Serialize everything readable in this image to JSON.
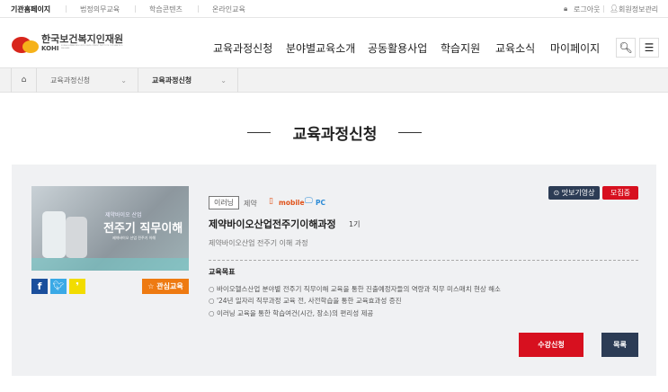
{
  "topbar": {
    "links": [
      "기관홈페이지",
      "법정의무교육",
      "학습콘텐츠",
      "온라인교육"
    ],
    "logout": "로그아웃",
    "member": "회원정보관리"
  },
  "logo": {
    "name": "한국보건복지인재원",
    "abbr": "KOHI",
    "sub": "KOREA HUMAN RESOURCE DEVELOPMENT INSTITUTE FOR HEALTH & WELFARE"
  },
  "nav": [
    "교육과정신청",
    "분야별교육소개",
    "공동활용사업",
    "학습지원",
    "교육소식",
    "마이페이지"
  ],
  "breadcrumb": [
    "교육과정신청",
    "교육과정신청"
  ],
  "page_title": "교육과정신청",
  "course": {
    "thumb": {
      "small": "제약바이오 산업",
      "big": "전주기 직무이해",
      "caption": "제약바이오 산업 전주기 이해"
    },
    "type_tag": "이러닝",
    "category": "제약",
    "mobile": "mobile",
    "pc": "PC",
    "preview": "맛보기영상",
    "status": "모집중",
    "title": "제약바이오산업전주기이해과정",
    "term": "1기",
    "subtitle": "제약바이오산업 전주기 이해 과정",
    "goal_label": "교육목표",
    "goals": [
      "바이오헬스산업 분야별 전주기 직무이해 교육을 통한 진출예정자들의 역량과 직무 미스매치 현상 해소",
      "'24년 일자리 직무과정 교육 전, 사전학습을 통한 교육효과성 증진",
      "이러닝 교육을 통한 학습여건(시간, 장소)의 편리성 제공"
    ],
    "interest": "관심교육",
    "apply": "수강신청",
    "list": "목록"
  },
  "colors": {
    "red": "#d7101f",
    "navy": "#2c3c55",
    "orange": "#ee7a11"
  }
}
